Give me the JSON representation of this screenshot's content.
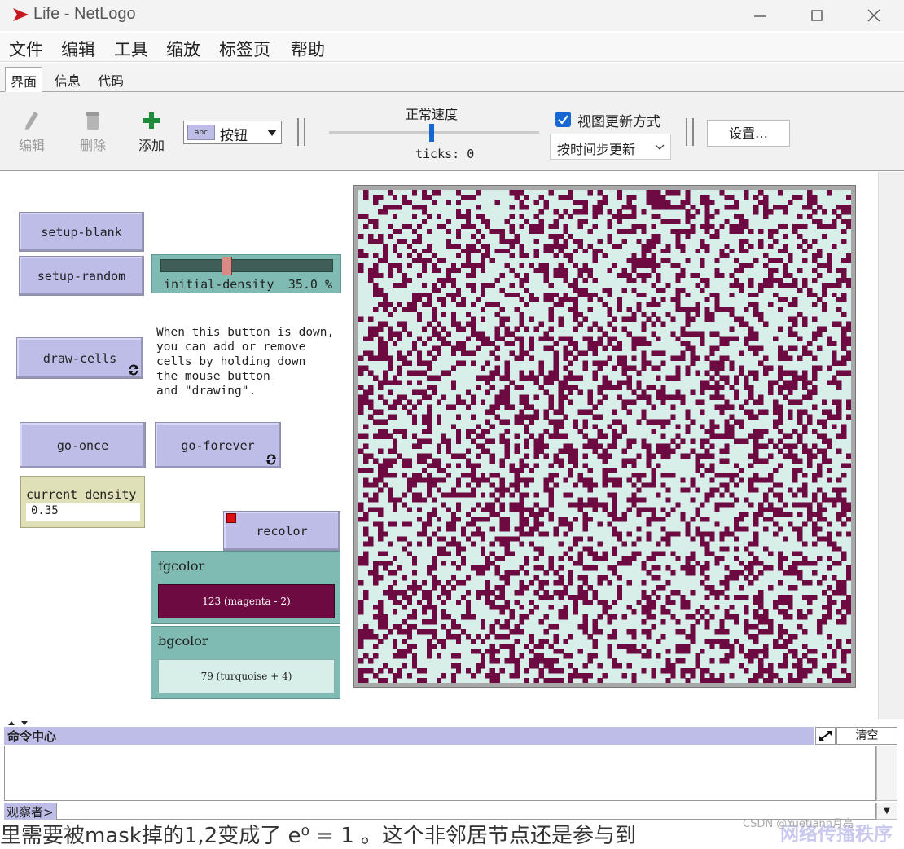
{
  "window": {
    "title": "Life - NetLogo",
    "app_icon": "netlogo-logo-icon",
    "controls": [
      "minimize-icon",
      "maximize-icon",
      "close-icon"
    ]
  },
  "menu": {
    "items": [
      "文件",
      "编辑",
      "工具",
      "缩放",
      "标签页",
      "帮助"
    ]
  },
  "tabs": [
    {
      "label": "界面",
      "active": true
    },
    {
      "label": "信息",
      "active": false
    },
    {
      "label": "代码",
      "active": false
    }
  ],
  "toolbar": {
    "edit_label": "编辑",
    "delete_label": "删除",
    "add_label": "添加",
    "widget_type": "按钮",
    "speed_label": "正常速度",
    "ticks_label": "ticks: 0",
    "view_update_label": "视图更新方式",
    "view_update_mode": "按时间步更新",
    "settings_label": "设置…"
  },
  "widgets": {
    "setup_blank": "setup-blank",
    "setup_random": "setup-random",
    "slider": {
      "name": "initial-density",
      "value": "35.0 %",
      "fraction": 0.35
    },
    "draw_cells": "draw-cells",
    "note": "When this button is down,\nyou can add or remove\ncells by holding down\nthe mouse button\nand \"drawing\".",
    "go_once": "go-once",
    "go_forever": "go-forever",
    "monitor": {
      "label": "current density",
      "value": "0.35"
    },
    "recolor": "recolor",
    "fgcolor": {
      "label": "fgcolor",
      "value": "123 (magenta - 2)",
      "color": "#6d0a41"
    },
    "bgcolor": {
      "label": "bgcolor",
      "value": "79 (turquoise + 4)",
      "color": "#d7efe8"
    }
  },
  "world": {
    "size": 101,
    "density": 0.35,
    "alive_color": "#6d0a41",
    "dead_color": "#d7efe8"
  },
  "command_center": {
    "title": "命令中心",
    "clear_label": "清空",
    "observer_label": "观察者>"
  },
  "background": {
    "text": "里需要被mask掉的1,2变成了 e⁰ = 1 。这个非邻居节点还是参与到",
    "watermark": "CSDN @Yuetiann月亮",
    "watermark_logo": "网络传播秩序"
  }
}
